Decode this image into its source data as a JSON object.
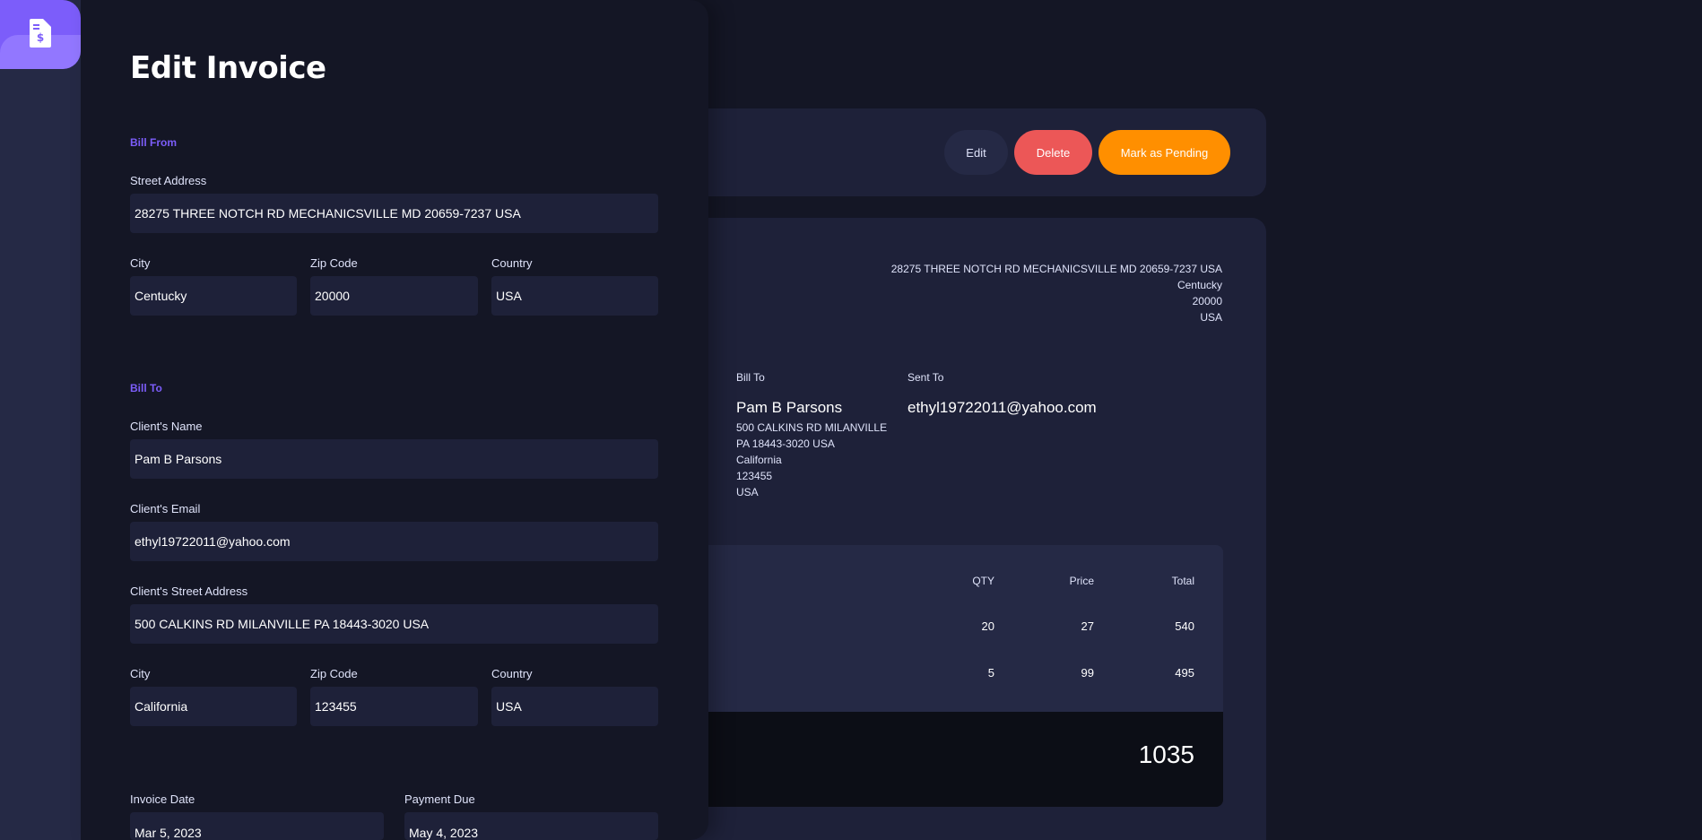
{
  "actions": {
    "edit_label": "Edit",
    "delete_label": "Delete",
    "pending_label": "Mark as Pending"
  },
  "detail": {
    "from_address_lines": [
      "28275 THREE NOTCH RD MECHANICSVILLE MD 20659-7237 USA",
      "Centucky",
      "20000",
      "USA"
    ],
    "bill_to_label": "Bill To",
    "sent_to_label": "Sent To",
    "client_name": "Pam B Parsons",
    "client_email": "ethyl19722011@yahoo.com",
    "client_address_lines": [
      "500 CALKINS RD MILANVILLE",
      "PA 18443-3020 USA",
      "California",
      "123455",
      "USA"
    ],
    "table_headers": {
      "qty": "QTY",
      "price": "Price",
      "total": "Total"
    },
    "rows": [
      {
        "qty": "20",
        "price": "27",
        "total": "540"
      },
      {
        "qty": "5",
        "price": "99",
        "total": "495"
      }
    ],
    "amount": "1035"
  },
  "editor": {
    "title": "Edit Invoice",
    "bill_from": {
      "heading": "Bill From",
      "street_label": "Street Address",
      "street": "28275  THREE NOTCH RD MECHANICSVILLE MD 20659-7237 USA",
      "city_label": "City",
      "city": "Centucky",
      "zip_label": "Zip Code",
      "zip": "20000",
      "country_label": "Country",
      "country": "USA"
    },
    "bill_to": {
      "heading": "Bill To",
      "name_label": "Client's Name",
      "name": "Pam B Parsons",
      "email_label": "Client's Email",
      "email": "ethyl19722011@yahoo.com",
      "street_label": "Client's Street Address",
      "street": "500 CALKINS RD MILANVILLE PA 18443-3020 USA",
      "city_label": "City",
      "city": "California",
      "zip_label": "Zip Code",
      "zip": "123455",
      "country_label": "Country",
      "country": "USA"
    },
    "invoice_date_label": "Invoice Date",
    "invoice_date": "Mar 5, 2023",
    "payment_due_label": "Payment Due",
    "payment_due": "May 4, 2023"
  },
  "colors": {
    "accent": "#7c5dfa",
    "delete": "#ec5757",
    "pending": "#ff8f00",
    "panel_bg": "#141625",
    "card_bg": "#1e2139"
  },
  "icons": {
    "logo": "invoice-document-icon"
  }
}
